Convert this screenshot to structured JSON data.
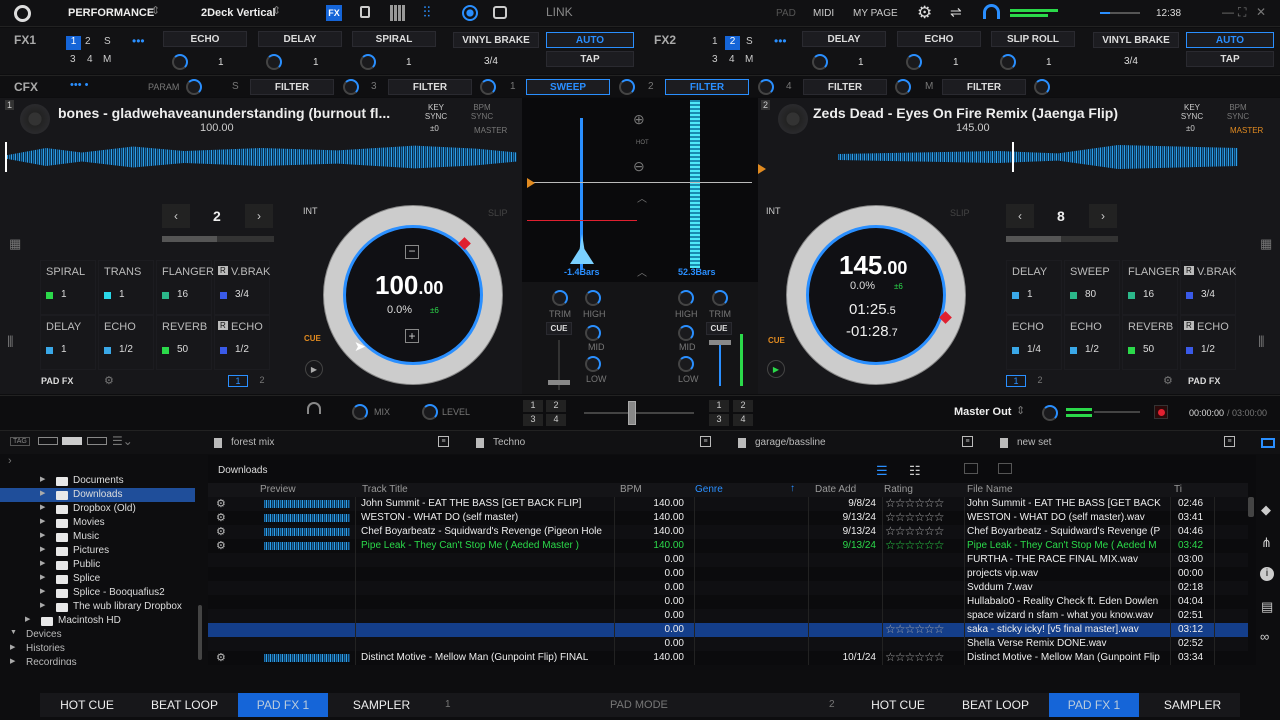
{
  "topbar": {
    "layout": "PERFORMANCE",
    "deck_mode": "2Deck Vertical",
    "fx_label": "FX",
    "link": "LINK",
    "pad": "PAD",
    "midi": "MIDI",
    "mypage": "MY PAGE",
    "clock": "12:38"
  },
  "fx1": {
    "label": "FX1",
    "slots": [
      "1",
      "2",
      "S",
      "3",
      "4",
      "M"
    ],
    "effects": [
      "ECHO",
      "DELAY",
      "SPIRAL"
    ],
    "beat_value": "1",
    "vinyl_brake": "VINYL BRAKE",
    "auto": "AUTO",
    "tap": "TAP",
    "beat": "3/4"
  },
  "fx2": {
    "label": "FX2",
    "slots": [
      "1",
      "2",
      "S",
      "3",
      "4",
      "M"
    ],
    "effects": [
      "DELAY",
      "ECHO",
      "SLIP ROLL"
    ],
    "beat_value": "1",
    "vinyl_brake": "VINYL BRAKE",
    "auto": "AUTO",
    "tap": "TAP",
    "beat": "3/4"
  },
  "cfx": {
    "label": "CFX",
    "param": "PARAM",
    "s": "S",
    "filter": "FILTER",
    "num3": "3",
    "num1": "1",
    "sweep": "SWEEP",
    "num2": "2",
    "num4": "4",
    "m": "M"
  },
  "deck1": {
    "number": "1",
    "title": "bones - gladwehaveanunderstanding (burnout fl...",
    "bpm_small": "100.00",
    "key_sync": "KEY SYNC",
    "key_val": "±0",
    "bpm_sync": "BPM SYNC",
    "master": "MASTER",
    "loop_value": "2",
    "int": "INT",
    "slip": "SLIP",
    "bpm_big": "100",
    "bpm_dec": ".00",
    "pitch": "0.0%",
    "pitch_range": "±6",
    "cue": "CUE",
    "pads": [
      {
        "t": "SPIRAL",
        "v": "1",
        "c": "#2bd94a"
      },
      {
        "t": "TRANS",
        "v": "1",
        "c": "#2ad8e8"
      },
      {
        "t": "FLANGER",
        "v": "16",
        "c": "#2bb88a"
      },
      {
        "t": "V.BRAK",
        "v": "3/4",
        "c": "#3a5ae8"
      },
      {
        "t": "DELAY",
        "v": "1",
        "c": "#3aa8e8"
      },
      {
        "t": "ECHO",
        "v": "1/2",
        "c": "#3aa8e8"
      },
      {
        "t": "REVERB",
        "v": "50",
        "c": "#2bd94a"
      },
      {
        "t": "ECHO",
        "v": "1/2",
        "c": "#3a5ae8"
      }
    ],
    "r_badge": "R",
    "pad_fx": "PAD FX",
    "page1": "1",
    "page2": "2"
  },
  "deck2": {
    "number": "2",
    "title": "Zeds Dead - Eyes On Fire Remix (Jaenga Flip)",
    "bpm_small": "145.00",
    "key_sync": "KEY SYNC",
    "key_val": "±0",
    "bpm_sync": "BPM SYNC",
    "master": "MASTER",
    "loop_value": "8",
    "int": "INT",
    "slip": "SLIP",
    "bpm_big": "145",
    "bpm_dec": ".00",
    "pitch": "0.0%",
    "pitch_range": "±6",
    "elapsed": "01:25",
    "elapsed_dec": ".5",
    "remain": "-01:28",
    "remain_dec": ".7",
    "cue": "CUE",
    "pads": [
      {
        "t": "DELAY",
        "v": "1",
        "c": "#3aa8e8"
      },
      {
        "t": "SWEEP",
        "v": "80",
        "c": "#2bb88a"
      },
      {
        "t": "FLANGER",
        "v": "16",
        "c": "#2bb88a"
      },
      {
        "t": "V.BRAK",
        "v": "3/4",
        "c": "#3a5ae8"
      },
      {
        "t": "ECHO",
        "v": "1/4",
        "c": "#3aa8e8"
      },
      {
        "t": "ECHO",
        "v": "1/2",
        "c": "#3aa8e8"
      },
      {
        "t": "REVERB",
        "v": "50",
        "c": "#2bd94a"
      },
      {
        "t": "ECHO",
        "v": "1/2",
        "c": "#3a5ae8"
      }
    ],
    "r_badge": "R",
    "pad_fx": "PAD FX",
    "page1": "1",
    "page2": "2"
  },
  "center": {
    "hot": "HOT",
    "left_bars": "-1.4Bars",
    "right_bars": "52.3Bars"
  },
  "mixer": {
    "trim": "TRIM",
    "high": "HIGH",
    "mid": "MID",
    "low": "LOW",
    "cue": "CUE"
  },
  "mixbar": {
    "mix": "MIX",
    "level": "LEVEL",
    "ch": [
      "1",
      "2",
      "3",
      "4"
    ],
    "master_out": "Master Out",
    "time_elapsed": "00:00:00",
    "time_total": "/ 03:00:00"
  },
  "playlists": [
    "forest mix",
    "Techno",
    "garage/bassline",
    "new set"
  ],
  "browser": {
    "tag": "TAG",
    "folder_title": "Downloads",
    "columns": [
      "Preview",
      "Track Title",
      "BPM",
      "Genre",
      "Date Add",
      "Rating",
      "File Name",
      "Ti"
    ],
    "rows": [
      {
        "title": "John Summit - EAT THE BASS [GET BACK FLIP]",
        "bpm": "140.00",
        "date": "9/8/24",
        "file": "John Summit - EAT THE BASS [GET BACK",
        "time": "02:46",
        "wf": true
      },
      {
        "title": "WESTON - WHAT DO (self master)",
        "bpm": "140.00",
        "date": "9/13/24",
        "file": "WESTON - WHAT DO (self master).wav",
        "time": "03:41",
        "wf": true
      },
      {
        "title": "Chef Boyarbeatz - Squidward's Revenge (Pigeon Hole",
        "bpm": "140.00",
        "date": "9/13/24",
        "file": "Chef Boyarbeatz - Squidward's Revenge (P",
        "time": "04:46",
        "wf": true
      },
      {
        "title": "Pipe Leak - They Can't Stop Me ( Aeded Master )",
        "bpm": "140.00",
        "date": "9/13/24",
        "file": "Pipe Leak - They Can't Stop Me ( Aeded M",
        "time": "03:42",
        "wf": true,
        "green": true
      },
      {
        "title": "",
        "bpm": "0.00",
        "date": "",
        "file": "FURTHA - THE RACE FINAL MIX.wav",
        "time": "03:00"
      },
      {
        "title": "",
        "bpm": "0.00",
        "date": "",
        "file": "projects vip.wav",
        "time": "00:00"
      },
      {
        "title": "",
        "bpm": "0.00",
        "date": "",
        "file": "Svddum 7.wav",
        "time": "02:18"
      },
      {
        "title": "",
        "bpm": "0.00",
        "date": "",
        "file": "Hullabalo0 - Reality Check ft. Eden Dowlen",
        "time": "04:04"
      },
      {
        "title": "",
        "bpm": "0.00",
        "date": "",
        "file": "space wizard n sfam - what you know.wav",
        "time": "02:51"
      },
      {
        "title": "",
        "bpm": "0.00",
        "date": "",
        "file": "saka - sticky icky! [v5 final master].wav",
        "time": "03:12",
        "selected": true
      },
      {
        "title": "",
        "bpm": "0.00",
        "date": "",
        "file": "Shella Verse Remix DONE.wav",
        "time": "02:52"
      },
      {
        "title": "Distinct Motive - Mellow Man (Gunpoint Flip) FINAL",
        "bpm": "140.00",
        "date": "10/1/24",
        "file": "Distinct Motive - Mellow Man (Gunpoint Flip",
        "time": "03:34",
        "wf": true
      }
    ],
    "stars": "☆☆☆☆☆☆"
  },
  "tree": [
    {
      "label": "Documents",
      "indent": 1,
      "folder": true,
      "arrow": "▶"
    },
    {
      "label": "Downloads",
      "indent": 1,
      "folder": true,
      "arrow": "▶",
      "selected": true
    },
    {
      "label": "Dropbox (Old)",
      "indent": 1,
      "folder": true,
      "arrow": "▶"
    },
    {
      "label": "Movies",
      "indent": 1,
      "folder": true,
      "arrow": "▶"
    },
    {
      "label": "Music",
      "indent": 1,
      "folder": true,
      "arrow": "▶"
    },
    {
      "label": "Pictures",
      "indent": 1,
      "folder": true,
      "arrow": "▶"
    },
    {
      "label": "Public",
      "indent": 1,
      "folder": true,
      "arrow": "▶"
    },
    {
      "label": "Splice",
      "indent": 1,
      "folder": true,
      "arrow": "▶"
    },
    {
      "label": "Splice - Booquafius2",
      "indent": 1,
      "folder": true,
      "arrow": "▶"
    },
    {
      "label": "The wub library Dropbox",
      "indent": 1,
      "folder": true,
      "arrow": "▶"
    },
    {
      "label": "Macintosh HD",
      "indent": 0.5,
      "folder": true,
      "arrow": "▶"
    },
    {
      "label": "Devices",
      "indent": 0,
      "folder": false,
      "arrow": "▼"
    },
    {
      "label": "Histories",
      "indent": 0,
      "folder": false,
      "arrow": "▶"
    },
    {
      "label": "Recordings",
      "indent": 0,
      "folder": false,
      "arrow": "▶"
    }
  ],
  "bottom": {
    "hot_cue": "HOT CUE",
    "beat_loop": "BEAT LOOP",
    "pad_fx1": "PAD FX 1",
    "sampler": "SAMPLER",
    "num1": "1",
    "pad_mode": "PAD MODE",
    "num2": "2"
  },
  "colors": {
    "accent": "#2a8fff",
    "active": "#1565d8",
    "green": "#2bd94a",
    "red": "#e02030",
    "orange": "#e08a20"
  }
}
